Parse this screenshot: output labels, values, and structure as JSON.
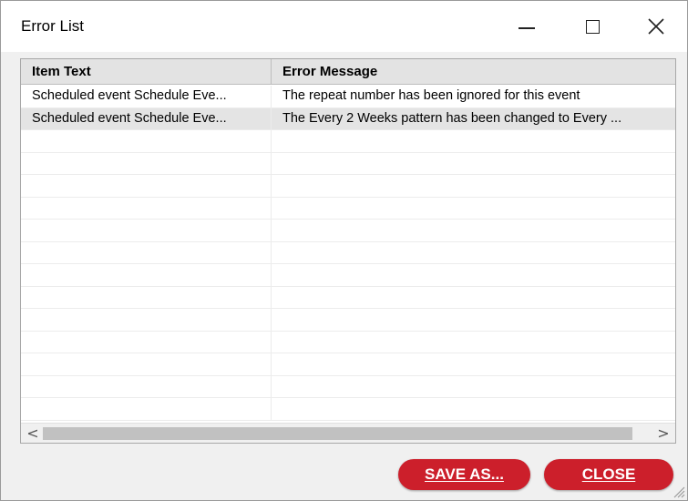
{
  "window": {
    "title": "Error List",
    "minimize_icon": "minimize-icon",
    "maximize_icon": "maximize-icon",
    "close_icon": "close-icon"
  },
  "table": {
    "columns": [
      "Item Text",
      "Error Message"
    ],
    "rows": [
      {
        "item_text": "Scheduled event Schedule Eve...",
        "error_message": "The repeat number has been ignored for this event"
      },
      {
        "item_text": "Scheduled event Schedule Eve...",
        "error_message": "The Every 2 Weeks pattern  has been changed to Every ..."
      }
    ],
    "selected_row": 1
  },
  "scrollbar": {
    "left_arrow": "<",
    "right_arrow": ">"
  },
  "buttons": {
    "save_as": "SAVE AS...",
    "close": "CLOSE"
  },
  "colors": {
    "button_red": "#cc1f2b",
    "header_gray": "#e3e3e3",
    "selected_row": "#e4e4e4"
  }
}
